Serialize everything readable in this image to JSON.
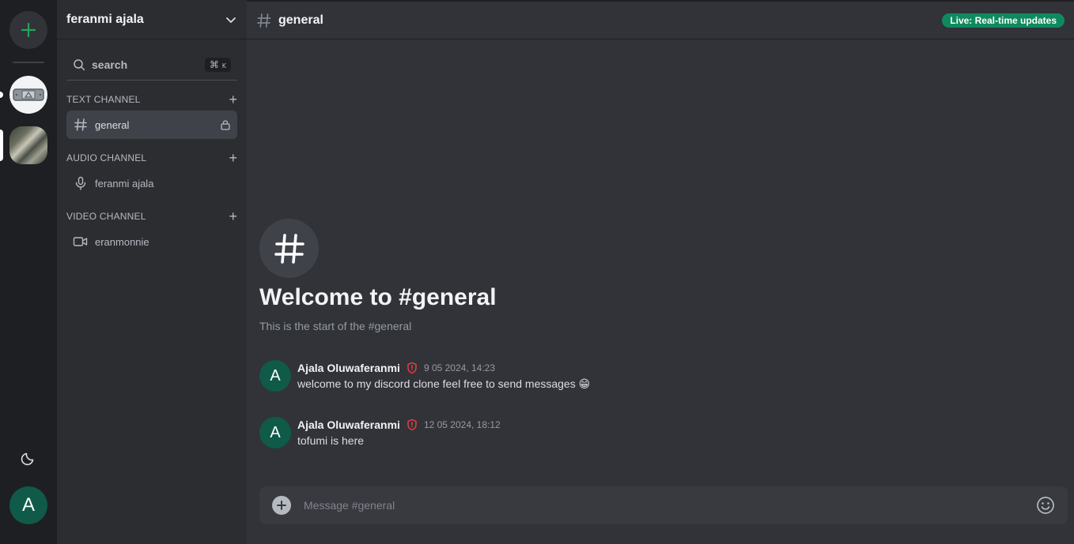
{
  "rail": {
    "add_server_icon": "plus-icon",
    "servers": [
      {
        "name": "server-1",
        "active": false
      },
      {
        "name": "server-2",
        "active": true
      }
    ],
    "theme_icon": "moon-icon",
    "user_initial": "A"
  },
  "sidebar": {
    "server_name": "feranmi ajala",
    "search_label": "search",
    "search_shortcut": "⌘",
    "search_shortcut_key": "K",
    "sections": [
      {
        "title": "TEXT CHANNEL",
        "channels": [
          {
            "name": "general",
            "icon": "hash-icon",
            "locked": true
          }
        ]
      },
      {
        "title": "AUDIO CHANNEL",
        "channels": [
          {
            "name": "feranmi ajala",
            "icon": "mic-icon"
          }
        ]
      },
      {
        "title": "VIDEO CHANNEL",
        "channels": [
          {
            "name": "eranmonnie",
            "icon": "video-icon"
          }
        ]
      }
    ]
  },
  "header": {
    "channel": "general",
    "badge": "Live: Real-time updates"
  },
  "welcome": {
    "title": "Welcome to #general",
    "subtitle": "This is the start of the #general"
  },
  "messages": [
    {
      "initial": "A",
      "author": "Ajala Oluwaferanmi",
      "time": "9 05 2024, 14:23",
      "text": "welcome to my discord clone feel free to send messages 😁"
    },
    {
      "initial": "A",
      "author": "Ajala Oluwaferanmi",
      "time": "12 05 2024, 18:12",
      "text": "tofumi is here"
    }
  ],
  "composer": {
    "placeholder": "Message #general"
  },
  "colors": {
    "accent_green": "#23a55a",
    "badge_green": "#0f8a5f",
    "avatar_green": "#0f5a48",
    "shield_red": "#f23f43"
  }
}
